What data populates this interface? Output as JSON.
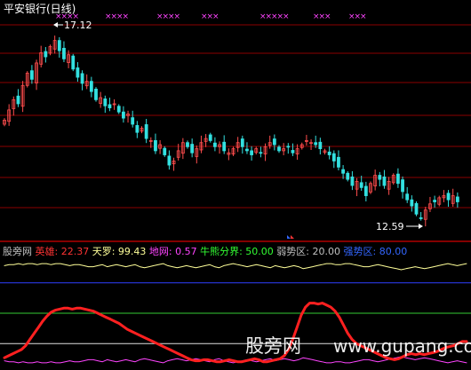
{
  "title": "平安银行(日线)",
  "price_panel": {
    "high_label": "17.12",
    "low_label": "12.59",
    "high_value": 17.12,
    "low_value": 12.59,
    "signal_marker": "×",
    "signal_marker_color": "#ff44ff",
    "signal_marker_counts": [
      4,
      4,
      4,
      3,
      5,
      3,
      3
    ]
  },
  "indicator_header": [
    {
      "text": "股旁网",
      "color": "#c0c0c0"
    },
    {
      "text": " 英雄: 22.37",
      "color": "#ff3333"
    },
    {
      "text": " 天罗: 99.43",
      "color": "#ffff99"
    },
    {
      "text": " 地网: 0.57",
      "color": "#ff44ff"
    },
    {
      "text": " 牛熊分界: 50.00",
      "color": "#33ff33"
    },
    {
      "text": " 弱势区: 20.00",
      "color": "#c0c0c0"
    },
    {
      "text": " 强势区: 80.00",
      "color": "#3366ff"
    }
  ],
  "watermark": {
    "text": "股旁网",
    "url": "www.gupang.com"
  },
  "colors": {
    "up_candle": "#ff4d4d",
    "down_candle": "#33e0e0",
    "grid": "#8b0000",
    "hero": "#ff2020",
    "tianluo": "#ffff99",
    "diwang": "#ff44ff",
    "bull_bear": "#33cc33",
    "weak": "#e0e0e0",
    "strong": "#2f3fff"
  },
  "chart_data": [
    {
      "type": "candlestick",
      "title": "平安银行(日线)",
      "ylim": [
        12.3,
        17.6
      ],
      "series": [
        {
          "name": "平安银行",
          "close": [
            15.05,
            15.3,
            15.55,
            15.45,
            15.9,
            16.2,
            16.05,
            16.45,
            16.7,
            16.6,
            16.85,
            17.0,
            16.75,
            16.55,
            16.65,
            16.3,
            16.1,
            15.95,
            16.0,
            15.75,
            15.55,
            15.6,
            15.4,
            15.35,
            15.45,
            15.25,
            15.1,
            15.2,
            14.95,
            14.75,
            14.85,
            14.6,
            14.55,
            14.3,
            14.45,
            14.2,
            13.95,
            14.05,
            14.3,
            14.5,
            14.4,
            14.25,
            14.35,
            14.5,
            14.6,
            14.55,
            14.4,
            14.45,
            14.3,
            14.25,
            14.35,
            14.5,
            14.4,
            14.3,
            14.2,
            14.35,
            14.25,
            14.4,
            14.5,
            14.45,
            14.3,
            14.35,
            14.4,
            14.25,
            14.35,
            14.45,
            14.55,
            14.5,
            14.45,
            14.35,
            14.3,
            14.2,
            14.05,
            13.9,
            13.75,
            13.6,
            13.45,
            13.55,
            13.4,
            13.2,
            13.5,
            13.7,
            13.6,
            13.45,
            13.55,
            13.7,
            13.5,
            13.3,
            13.1,
            12.95,
            12.75,
            12.65,
            12.85,
            13.0,
            13.05,
            13.15,
            13.2,
            13.1,
            13.2,
            13.05
          ]
        }
      ]
    },
    {
      "type": "line",
      "title": "",
      "ylim": [
        0,
        100
      ],
      "series": [
        {
          "name": "英雄",
          "values": [
            6,
            8,
            10,
            12,
            14,
            18,
            24,
            30,
            36,
            42,
            47,
            51,
            53,
            54,
            55,
            55,
            54,
            55,
            55,
            54,
            53,
            52,
            50,
            48,
            46,
            44,
            42,
            40,
            37,
            34,
            32,
            30,
            28,
            26,
            24,
            22,
            20,
            18,
            16,
            14,
            12,
            10,
            8,
            6,
            4,
            3,
            3,
            4,
            4,
            3,
            2,
            2,
            3,
            4,
            3,
            2,
            2,
            3,
            4,
            5,
            4,
            2,
            2,
            3,
            4,
            5,
            8,
            14,
            24,
            36,
            48,
            56,
            60,
            60,
            59,
            60,
            58,
            56,
            52,
            46,
            38,
            30,
            24,
            20,
            18,
            16,
            14,
            12,
            10,
            8,
            6,
            5,
            4,
            5,
            7,
            9,
            10,
            9,
            10,
            9,
            10,
            11,
            12,
            14,
            16,
            17,
            18,
            20,
            22,
            22
          ]
        },
        {
          "name": "天罗",
          "values": [
            97,
            98,
            98,
            99,
            98,
            99,
            99,
            98,
            99,
            99,
            98,
            99,
            99,
            98,
            97,
            98,
            98,
            97,
            96,
            96,
            97,
            98,
            96,
            97,
            98,
            97,
            96,
            97,
            98,
            96,
            95,
            96,
            97,
            98,
            99,
            97,
            96,
            95,
            96,
            97,
            96,
            95,
            96,
            97,
            98,
            96,
            95,
            97,
            98,
            99,
            98,
            97,
            96,
            97,
            98,
            97,
            96,
            95,
            97,
            96,
            95,
            96,
            97,
            96,
            94,
            95,
            96,
            97,
            98,
            99,
            99,
            98,
            98,
            99,
            99,
            98,
            97,
            96,
            96,
            97,
            98,
            97,
            96,
            95,
            94,
            93,
            94,
            95,
            96,
            95,
            94,
            95,
            96,
            97,
            98,
            99,
            98,
            97,
            98,
            99
          ]
        },
        {
          "name": "地网",
          "values": [
            3,
            2,
            2,
            1,
            2,
            1,
            1,
            2,
            1,
            1,
            2,
            1,
            1,
            2,
            3,
            2,
            2,
            3,
            4,
            4,
            3,
            2,
            4,
            3,
            2,
            3,
            4,
            3,
            2,
            4,
            5,
            4,
            3,
            2,
            1,
            3,
            4,
            5,
            4,
            3,
            4,
            5,
            4,
            3,
            2,
            4,
            5,
            3,
            2,
            1,
            2,
            3,
            4,
            3,
            2,
            3,
            4,
            5,
            3,
            4,
            5,
            4,
            3,
            4,
            6,
            5,
            4,
            3,
            2,
            1,
            1,
            2,
            2,
            1,
            1,
            2,
            3,
            4,
            4,
            3,
            2,
            3,
            4,
            5,
            6,
            7,
            6,
            5,
            4,
            5,
            6,
            5,
            4,
            3,
            2,
            1,
            2,
            3,
            2,
            1
          ]
        },
        {
          "name": "牛熊分界",
          "values": [
            50
          ]
        },
        {
          "name": "弱势区",
          "values": [
            20
          ]
        },
        {
          "name": "强势区",
          "values": [
            80
          ]
        }
      ]
    }
  ]
}
